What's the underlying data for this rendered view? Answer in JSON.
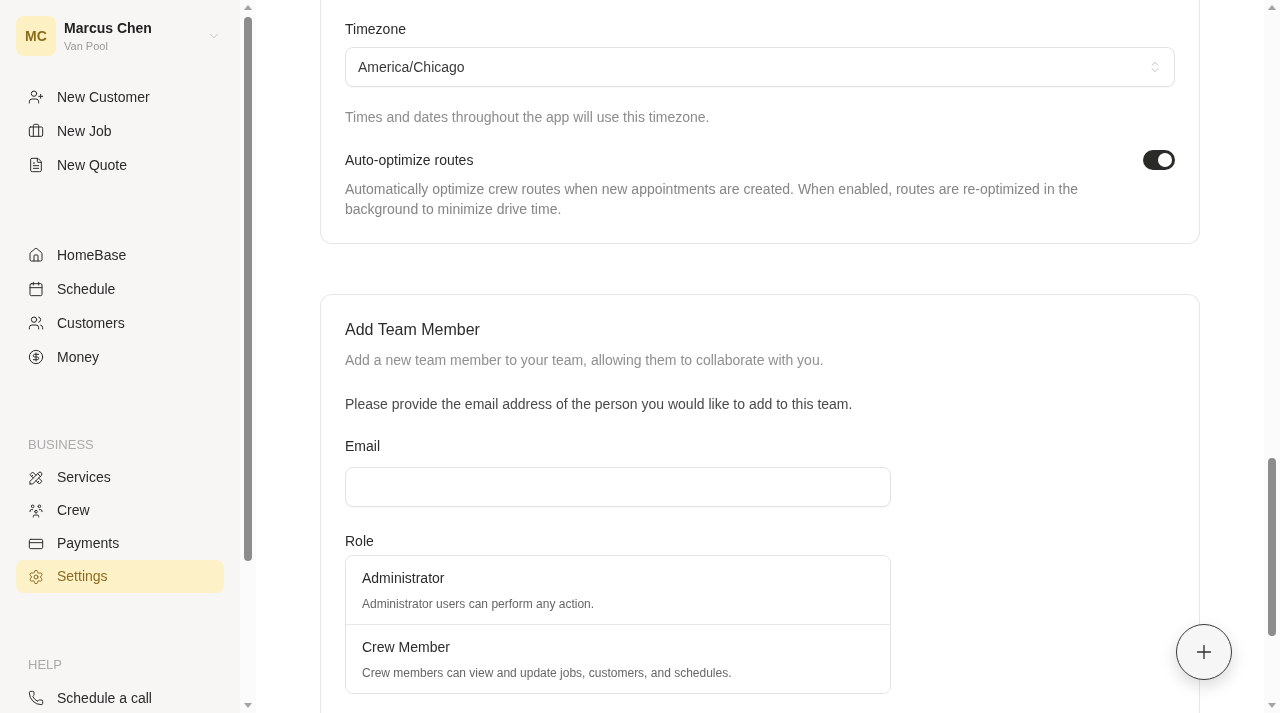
{
  "sidebar": {
    "user": {
      "initials": "MC",
      "name": "Marcus Chen",
      "subtitle": "Van Pool"
    },
    "quick_actions": [
      {
        "label": "New Customer"
      },
      {
        "label": "New Job"
      },
      {
        "label": "New Quote"
      }
    ],
    "nav": [
      {
        "label": "HomeBase",
        "selected": false
      },
      {
        "label": "Schedule",
        "selected": false
      },
      {
        "label": "Customers",
        "selected": false
      },
      {
        "label": "Money",
        "selected": false
      }
    ],
    "sections": [
      {
        "title": "BUSINESS",
        "items": [
          {
            "label": "Services",
            "selected": false
          },
          {
            "label": "Crew",
            "selected": false
          },
          {
            "label": "Payments",
            "selected": false
          },
          {
            "label": "Settings",
            "selected": true
          }
        ]
      },
      {
        "title": "HELP",
        "items": [
          {
            "label": "Schedule a call",
            "selected": false
          }
        ]
      }
    ]
  },
  "general_settings": {
    "timezone": {
      "label": "Timezone",
      "value": "America/Chicago",
      "hint": "Times and dates throughout the app will use this timezone."
    },
    "auto_optimize": {
      "label": "Auto-optimize routes",
      "on": true,
      "description": "Automatically optimize crew routes when new appointments are created. When enabled, routes are re-optimized in the background to minimize drive time."
    }
  },
  "add_team_member": {
    "title": "Add Team Member",
    "subtitle": "Add a new team member to your team, allowing them to collaborate with you.",
    "instructions": "Please provide the email address of the person you would like to add to this team.",
    "email": {
      "label": "Email"
    },
    "role": {
      "label": "Role",
      "options": [
        {
          "name": "Administrator",
          "description": "Administrator users can perform any action.",
          "selected": false
        },
        {
          "name": "Crew Member",
          "description": "Crew members can view and update jobs, customers, and schedules.",
          "selected": false
        }
      ]
    }
  }
}
